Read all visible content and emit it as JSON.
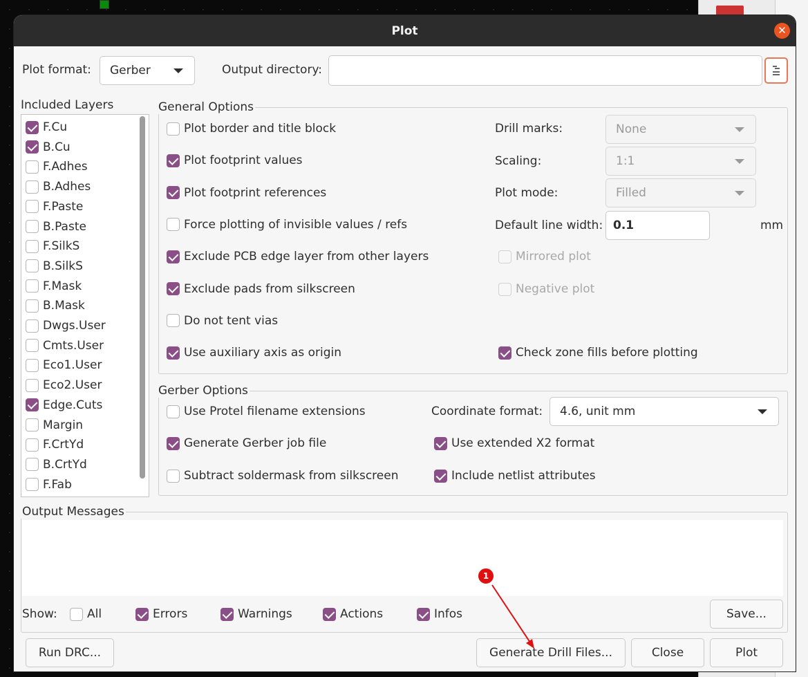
{
  "window": {
    "title": "Plot"
  },
  "top": {
    "plot_format_label": "Plot format:",
    "plot_format_value": "Gerber",
    "output_dir_label": "Output directory:",
    "output_dir_value": ""
  },
  "layers": {
    "title": "Included Layers",
    "items": [
      {
        "name": "F.Cu",
        "checked": true
      },
      {
        "name": "B.Cu",
        "checked": true
      },
      {
        "name": "F.Adhes",
        "checked": false
      },
      {
        "name": "B.Adhes",
        "checked": false
      },
      {
        "name": "F.Paste",
        "checked": false
      },
      {
        "name": "B.Paste",
        "checked": false
      },
      {
        "name": "F.SilkS",
        "checked": false
      },
      {
        "name": "B.SilkS",
        "checked": false
      },
      {
        "name": "F.Mask",
        "checked": false
      },
      {
        "name": "B.Mask",
        "checked": false
      },
      {
        "name": "Dwgs.User",
        "checked": false
      },
      {
        "name": "Cmts.User",
        "checked": false
      },
      {
        "name": "Eco1.User",
        "checked": false
      },
      {
        "name": "Eco2.User",
        "checked": false
      },
      {
        "name": "Edge.Cuts",
        "checked": true
      },
      {
        "name": "Margin",
        "checked": false
      },
      {
        "name": "F.CrtYd",
        "checked": false
      },
      {
        "name": "B.CrtYd",
        "checked": false
      },
      {
        "name": "F.Fab",
        "checked": false
      }
    ]
  },
  "general": {
    "title": "General Options",
    "left": [
      {
        "label": "Plot border and title block",
        "checked": false
      },
      {
        "label": "Plot footprint values",
        "checked": true
      },
      {
        "label": "Plot footprint references",
        "checked": true
      },
      {
        "label": "Force plotting of invisible values / refs",
        "checked": false
      },
      {
        "label": "Exclude PCB edge layer from other layers",
        "checked": true
      },
      {
        "label": "Exclude pads from silkscreen",
        "checked": true
      },
      {
        "label": "Do not tent vias",
        "checked": false
      },
      {
        "label": "Use auxiliary axis as origin",
        "checked": true
      }
    ],
    "drill_marks_label": "Drill marks:",
    "drill_marks_value": "None",
    "scaling_label": "Scaling:",
    "scaling_value": "1:1",
    "plot_mode_label": "Plot mode:",
    "plot_mode_value": "Filled",
    "line_width_label": "Default line width:",
    "line_width_value": "0.1",
    "line_width_unit": "mm",
    "mirrored_label": "Mirrored plot",
    "negative_label": "Negative plot",
    "check_zone_label": "Check zone fills before plotting",
    "check_zone_checked": true
  },
  "gerber": {
    "title": "Gerber Options",
    "protel_label": "Use Protel filename extensions",
    "protel_checked": false,
    "job_label": "Generate Gerber job file",
    "job_checked": true,
    "subtract_label": "Subtract soldermask from silkscreen",
    "subtract_checked": false,
    "coord_label": "Coordinate format:",
    "coord_value": "4.6, unit mm",
    "x2_label": "Use extended X2 format",
    "x2_checked": true,
    "netlist_label": "Include netlist attributes",
    "netlist_checked": true
  },
  "messages": {
    "title": "Output Messages",
    "show_label": "Show:",
    "filters": [
      {
        "label": "All",
        "checked": false
      },
      {
        "label": "Errors",
        "checked": true
      },
      {
        "label": "Warnings",
        "checked": true
      },
      {
        "label": "Actions",
        "checked": true
      },
      {
        "label": "Infos",
        "checked": true
      }
    ],
    "save_label": "Save..."
  },
  "buttons": {
    "run_drc": "Run DRC...",
    "drill": "Generate Drill Files...",
    "close": "Close",
    "plot": "Plot"
  },
  "annotation": {
    "marker": "1",
    "color": "#e01010"
  },
  "colors": {
    "accent": "#8b4f87",
    "titlebar": "#2c2c2c",
    "close": "#e95420"
  }
}
